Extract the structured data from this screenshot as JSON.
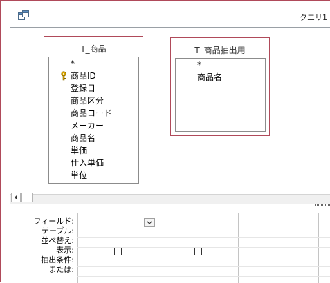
{
  "window": {
    "title": "クエリ1"
  },
  "tables": [
    {
      "name": "T_商品",
      "fields": [
        {
          "label": "*",
          "key": false
        },
        {
          "label": "商品ID",
          "key": true
        },
        {
          "label": "登録日",
          "key": false
        },
        {
          "label": "商品区分",
          "key": false
        },
        {
          "label": "商品コード",
          "key": false
        },
        {
          "label": "メーカー",
          "key": false
        },
        {
          "label": "商品名",
          "key": false
        },
        {
          "label": "単価",
          "key": false
        },
        {
          "label": "仕入単価",
          "key": false
        },
        {
          "label": "単位",
          "key": false
        }
      ]
    },
    {
      "name": "T_商品抽出用",
      "fields": [
        {
          "label": "*",
          "key": false
        },
        {
          "label": "商品名",
          "key": false
        }
      ]
    }
  ],
  "qbe": {
    "row_labels": [
      "フィールド:",
      "テーブル:",
      "並べ替え:",
      "表示:",
      "抽出条件:",
      "または:"
    ],
    "columns": [
      {
        "field": "",
        "show": false
      },
      {
        "field": "",
        "show": false
      },
      {
        "field": "",
        "show": false
      },
      {
        "field": "",
        "show": false
      }
    ]
  },
  "colors": {
    "table_border": "#b04a5a",
    "key_icon": "#d8a400"
  },
  "icons": {
    "window_icon": "query-design-icon",
    "key": "primary-key-icon"
  }
}
